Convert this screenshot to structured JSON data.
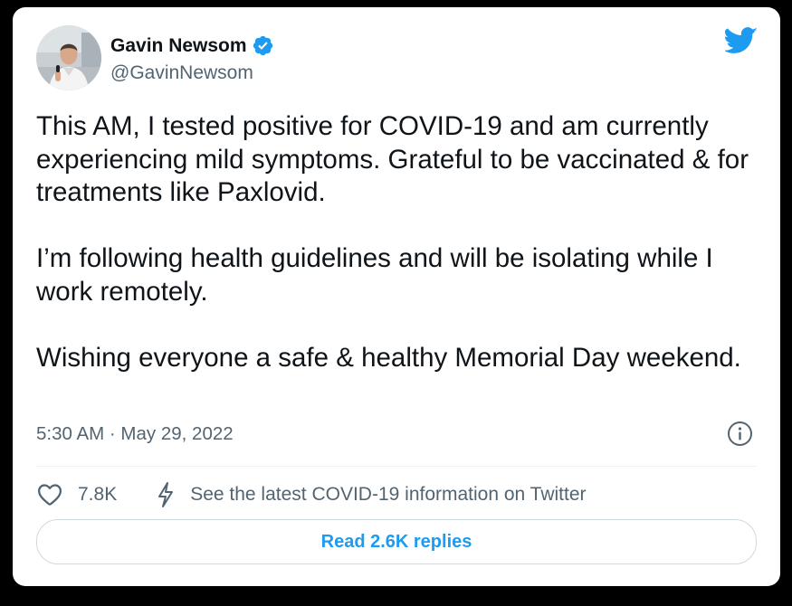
{
  "colors": {
    "brand_blue": "#1d9bf0",
    "text_primary": "#0f1419",
    "text_secondary": "#536471",
    "border": "#cfd9de",
    "page_background": "#000000",
    "card_background": "#ffffff"
  },
  "author": {
    "display_name": "Gavin Newsom",
    "handle": "@GavinNewsom",
    "verified": true,
    "verified_icon": "verified-badge-icon",
    "avatar_icon": "avatar"
  },
  "brand_icon": "twitter-bird-icon",
  "tweet": {
    "paragraphs": [
      "This AM, I tested positive for COVID-19 and am currently experiencing mild symptoms. Grateful to be vaccinated & for treatments like Paxlovid.",
      "I’m following health guidelines and will be isolating while I work remotely.",
      "Wishing everyone a safe & healthy Memorial Day weekend."
    ],
    "timestamp": "5:30 AM · May 29, 2022"
  },
  "info_icon": "info-icon",
  "actions": {
    "like": {
      "icon": "heart-icon",
      "count": "7.8K"
    },
    "covid_info": {
      "icon": "lightning-bolt-icon",
      "label": "See the latest COVID-19 information on Twitter"
    }
  },
  "replies_button": {
    "label": "Read 2.6K replies"
  }
}
